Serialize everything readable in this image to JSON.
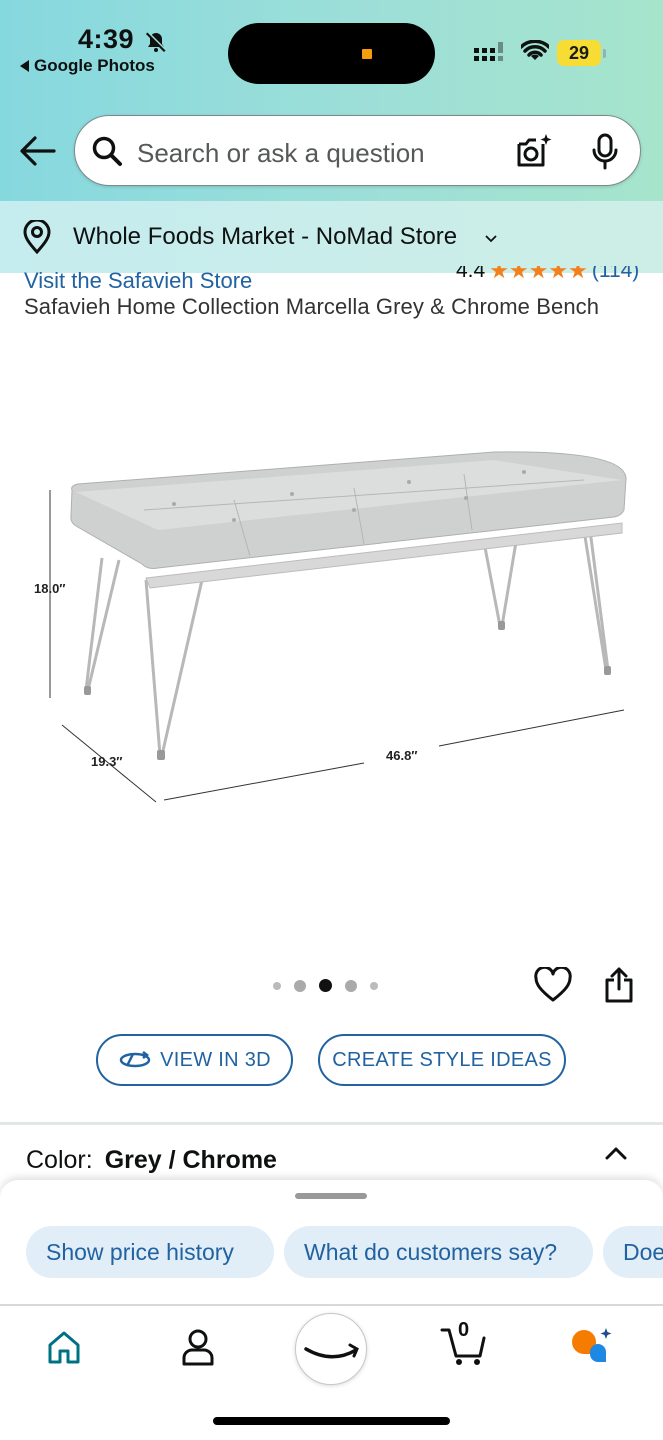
{
  "status_bar": {
    "time": "4:39",
    "back_app_label": "Google Photos",
    "battery": "29"
  },
  "search": {
    "placeholder": "Search or ask a question"
  },
  "location": {
    "label": "Whole Foods Market - NoMad Store"
  },
  "product": {
    "store_link": "Visit the Safavieh Store",
    "rating": "4.4",
    "rating_count": "(114)",
    "stars": "★★★★★",
    "title": "Safavieh Home Collection Marcella Grey & Chrome Bench",
    "image_dimensions": {
      "height": "18.0″",
      "depth": "19.3″",
      "width": "46.8″"
    },
    "carousel": {
      "total": 5,
      "active_index": 2
    }
  },
  "actions": {
    "view_3d": "VIEW IN 3D",
    "style_ideas": "CREATE STYLE IDEAS"
  },
  "color": {
    "label": "Color:",
    "value": "Grey / Chrome"
  },
  "suggestions": [
    "Show price history",
    "What do customers say?",
    "Doe"
  ],
  "nav": {
    "cart_count": "0"
  },
  "colors": {
    "link": "#2162a1",
    "header_gradient_start": "#86d8df",
    "header_gradient_end": "#a6e4cc",
    "star": "#f3801d",
    "chip_bg": "#e1eef8"
  }
}
